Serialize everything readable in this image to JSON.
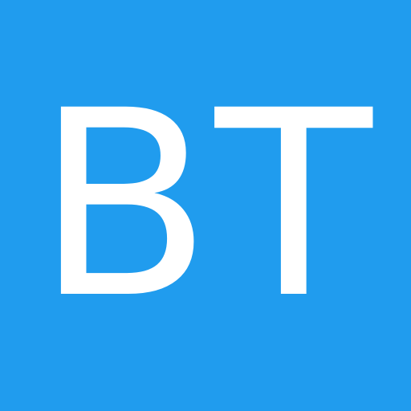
{
  "avatar": {
    "initials": "BT",
    "background_color": "#209cee",
    "text_color": "#ffffff"
  }
}
